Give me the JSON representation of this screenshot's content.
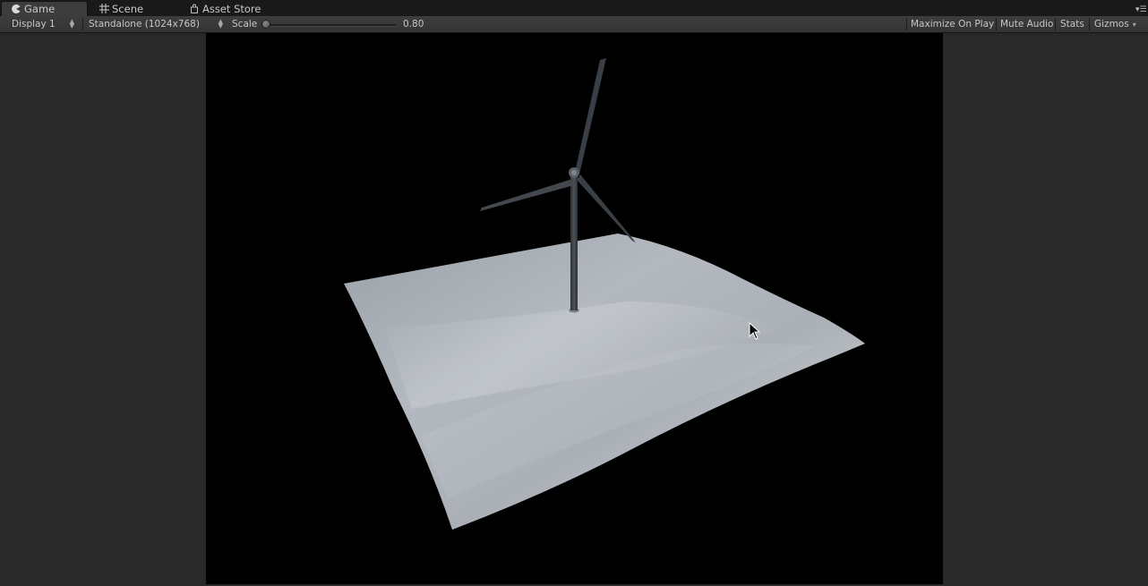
{
  "tabs": [
    {
      "label": "Game",
      "icon": "pacman-icon",
      "active": true
    },
    {
      "label": "Scene",
      "icon": "grid-icon",
      "active": false
    },
    {
      "label": "Asset Store",
      "icon": "bag-icon",
      "active": false
    }
  ],
  "toolbar": {
    "display": "Display 1",
    "resolution": "Standalone (1024x768)",
    "scale_label": "Scale",
    "scale_value": "0.80",
    "scale_level": 0.0,
    "maximize_on_play": "Maximize On Play",
    "mute_audio": "Mute Audio",
    "stats": "Stats",
    "gizmos": "Gizmos"
  },
  "scene": {
    "background_color": "#000000",
    "terrain_color": "#b7bdc3",
    "turbine_color": "#3e4247"
  },
  "colors": {
    "editor_bg": "#292929",
    "tab_active": "#3c3c3c",
    "toolbar": "#383838"
  }
}
